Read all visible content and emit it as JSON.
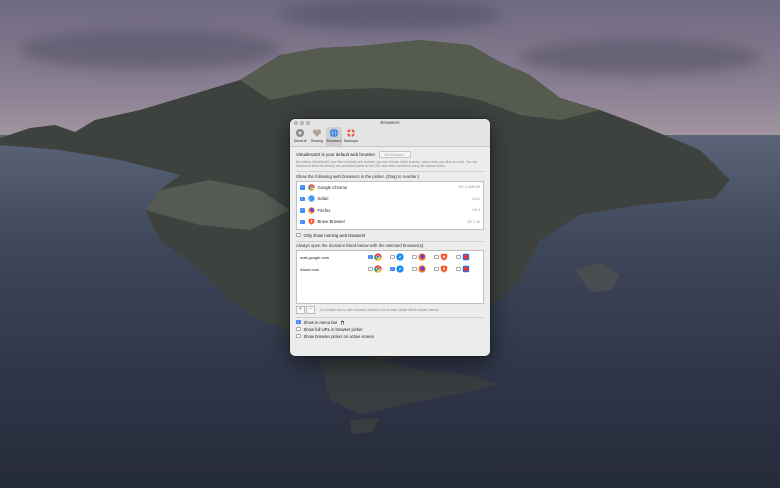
{
  "window": {
    "title": "Browsers",
    "tabs": [
      {
        "label": "General",
        "icon": "gear-icon"
      },
      {
        "label": "Sharing",
        "icon": "heart-icon"
      },
      {
        "label": "Browsers",
        "icon": "globe-icon",
        "active": true
      },
      {
        "label": "Backups",
        "icon": "lifebuoy-icon"
      }
    ]
  },
  "default": {
    "text": "VirtualHostX is your default web browser.",
    "button": "Set Default...",
    "description": "By making VirtualHostX your Mac's default web browser, you can choose which browser opens when you click on a link. You can customize which browser(s) are activated based on the URL and other conditions using the options below."
  },
  "browsers": {
    "title": "Show the following web browsers in the picker. (Drag to reorder.)",
    "items": [
      {
        "name": "Google Chrome",
        "version": "v87.0.4280.88",
        "checked": true,
        "color": "#e8453c"
      },
      {
        "name": "Safari",
        "version": "v14.0",
        "checked": true,
        "color": "#1e8ff0"
      },
      {
        "name": "Firefox",
        "version": "v78.0",
        "checked": true,
        "color": "#ff7a1a"
      },
      {
        "name": "Brave Browser",
        "version": "v87.1.18",
        "checked": true,
        "color": "#fb542b"
      }
    ],
    "only_running": "Only show running web browsers"
  },
  "domains": {
    "title": "Always open the domains listed below with the selected browser(s).",
    "rows": [
      {
        "domain": "mail.google.com",
        "checks": [
          true,
          false,
          false,
          false,
          false
        ]
      },
      {
        "domain": "icloud.com",
        "checks": [
          false,
          true,
          false,
          false,
          false
        ]
      }
    ],
    "note": "If a domain has no web browsers selected, the browser picker will be shown instead."
  },
  "options": {
    "show_in_menu_bar": "Show in menu bar",
    "show_full_url": "Show full URL in browser picker",
    "show_on_active": "Show browser picker on active screen"
  }
}
